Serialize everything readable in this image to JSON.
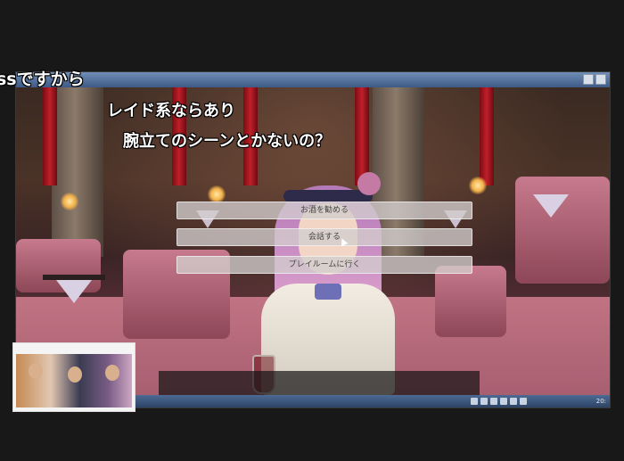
{
  "comments": [
    "ssですから",
    "レイド系ならあり",
    "腕立てのシーンとかないの？"
  ],
  "menu": {
    "options": [
      "お酒を勧める",
      "会話する",
      "プレイルームに行く"
    ]
  },
  "taskbar": {
    "clock": "20:"
  },
  "colors": {
    "menu_bg": "#d2cdcd",
    "titlebar": "#4d6a93",
    "comment_text": "#ffffff"
  }
}
